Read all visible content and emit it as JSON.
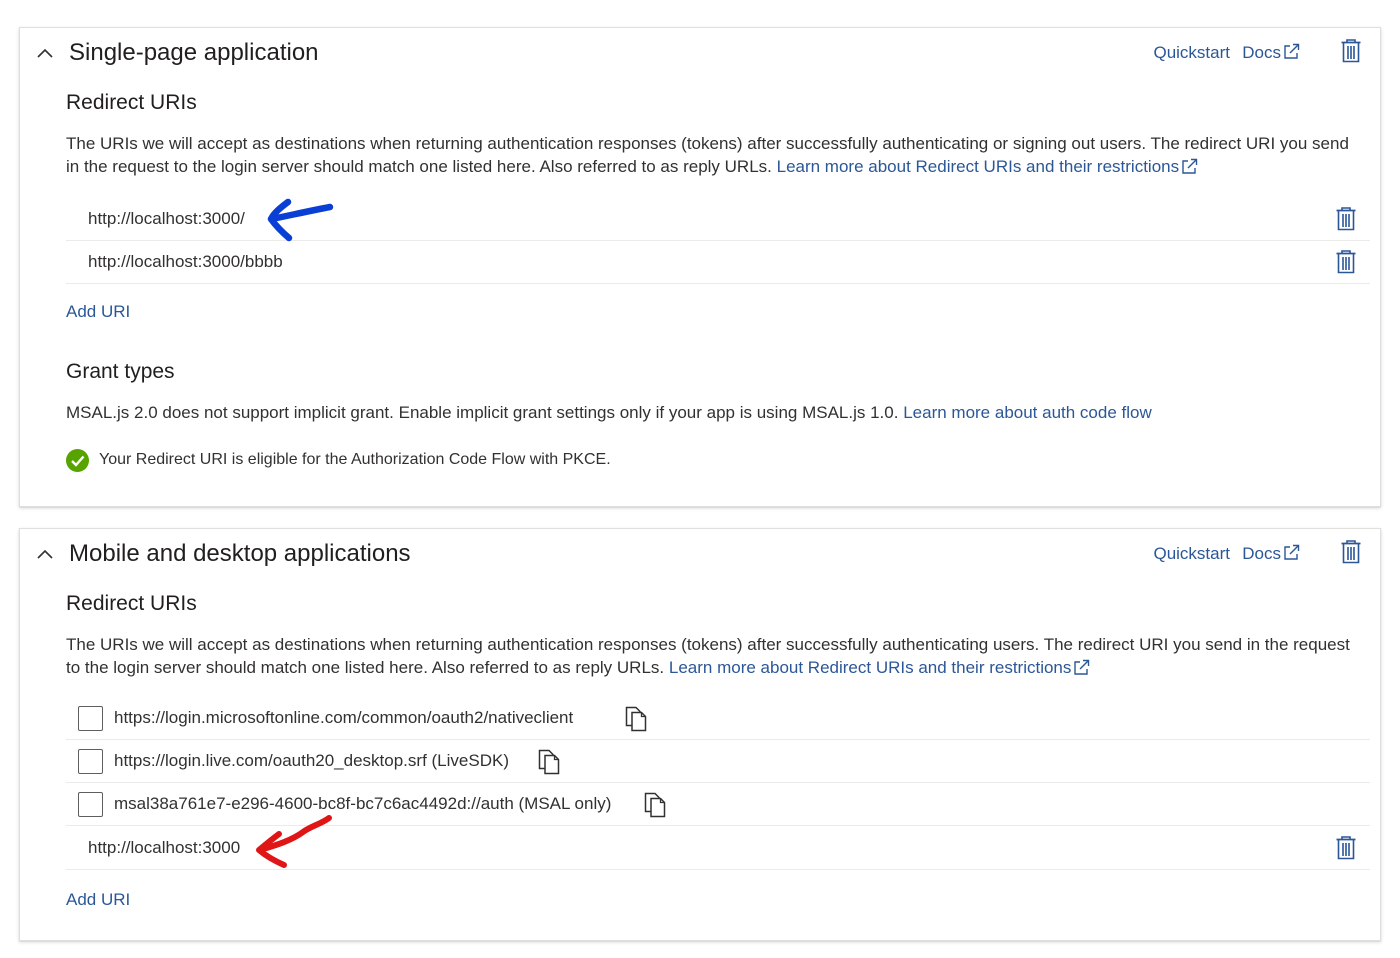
{
  "colors": {
    "link": "#2b5797",
    "icon_blue": "#2b5797",
    "success_green": "#57a300",
    "annotation_blue": "#0a3fd6",
    "annotation_red": "#e01616"
  },
  "icons": {
    "collapse": "chevron-up-icon",
    "delete": "trash-icon",
    "external": "external-link-icon",
    "copy": "copy-icon",
    "success": "check-circle-icon"
  },
  "spa": {
    "title": "Single-page application",
    "quickstart": "Quickstart",
    "docs": "Docs",
    "redirect_title": "Redirect URIs",
    "redirect_desc": "The URIs we will accept as destinations when returning authentication responses (tokens) after successfully authenticating or signing out users. The redirect URI you send in the request to the login server should match one listed here. Also referred to as reply URLs.",
    "redirect_link": "Learn more about Redirect URIs and their restrictions",
    "uris": [
      "http://localhost:3000/",
      "http://localhost:3000/bbbb"
    ],
    "add_uri": "Add URI",
    "grant_title": "Grant types",
    "grant_desc": "MSAL.js 2.0 does not support implicit grant. Enable implicit grant settings only if your app is using MSAL.js 1.0.",
    "grant_link": "Learn more about auth code flow",
    "eligible_text": "Your Redirect URI is eligible for the Authorization Code Flow with PKCE."
  },
  "mobile": {
    "title": "Mobile and desktop applications",
    "quickstart": "Quickstart",
    "docs": "Docs",
    "redirect_title": "Redirect URIs",
    "redirect_desc": "The URIs we will accept as destinations when returning authentication responses (tokens) after successfully authenticating users. The redirect URI you send in the request to the login server should match one listed here. Also referred to as reply URLs.",
    "redirect_link": "Learn more about Redirect URIs and their restrictions",
    "suggested": [
      {
        "uri": "https://login.microsoftonline.com/common/oauth2/nativeclient",
        "checked": false
      },
      {
        "uri": "https://login.live.com/oauth20_desktop.srf (LiveSDK)",
        "checked": false
      },
      {
        "uri": "msal38a761e7-e296-4600-bc8f-bc7c6ac4492d://auth (MSAL only)",
        "checked": false
      }
    ],
    "custom_uris": [
      "http://localhost:3000"
    ],
    "add_uri": "Add URI"
  }
}
